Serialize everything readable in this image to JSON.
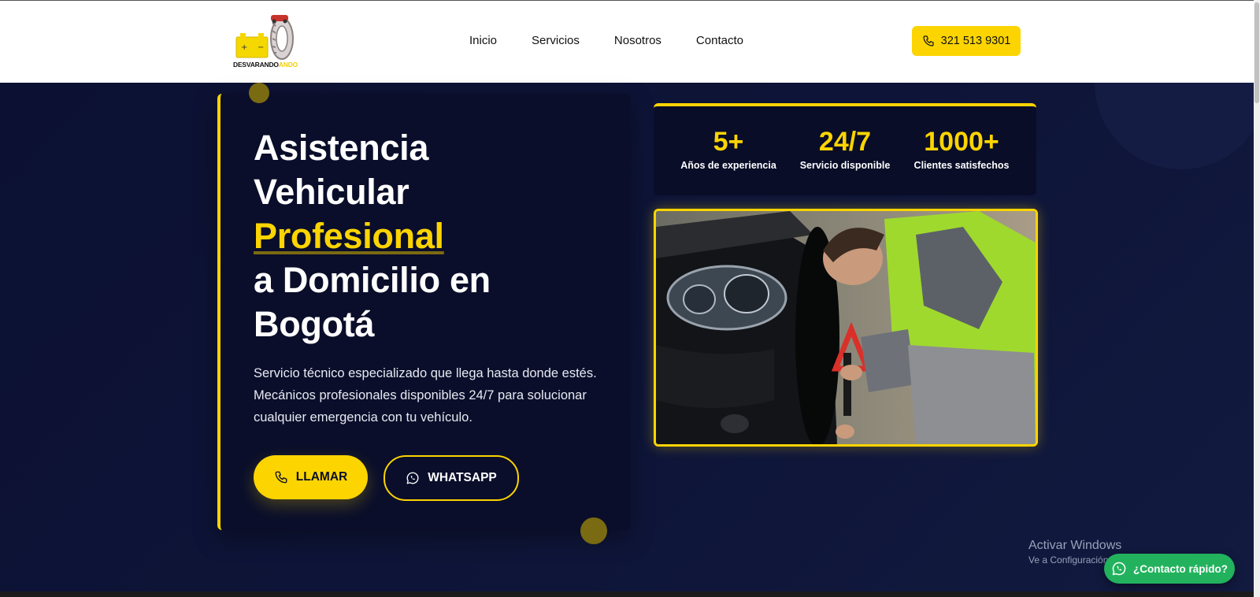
{
  "header": {
    "logo": {
      "name": "DESVARANDO",
      "accent": "ANDO"
    },
    "nav": [
      "Inicio",
      "Servicios",
      "Nosotros",
      "Contacto"
    ],
    "phone": {
      "icon": "phone-icon",
      "number": "321 513 9301"
    }
  },
  "hero": {
    "title": [
      "Asistencia",
      "Vehicular",
      "Profesional",
      "a Domicilio en",
      "Bogotá"
    ],
    "description": "Servicio técnico especializado que llega hasta donde estés. Mecánicos profesionales disponibles 24/7 para solucionar cualquier emergencia con tu vehículo.",
    "call_button": {
      "icon": "phone-icon",
      "label": "LLAMAR"
    },
    "whatsapp_button": {
      "icon": "whatsapp-icon",
      "label": "WHATSAPP"
    }
  },
  "stats": [
    {
      "value": "5+",
      "label": "Años de experiencia"
    },
    {
      "value": "24/7",
      "label": "Servicio disponible"
    },
    {
      "value": "1000+",
      "label": "Clientes satisfechos"
    }
  ],
  "photo": {
    "subject": "mechanic-changing-tire-image"
  },
  "watermark": {
    "title": "Activar Windows",
    "subtitle": "Ve a Configuración para activar Windows."
  },
  "contact_fab": {
    "icon": "whatsapp-icon",
    "label": "¿Contacto rápido?"
  },
  "colors": {
    "accent": "#fcd400",
    "navy": "#0c1132",
    "card": "#0a0e2a",
    "whatsapp_green": "#22b25d"
  }
}
